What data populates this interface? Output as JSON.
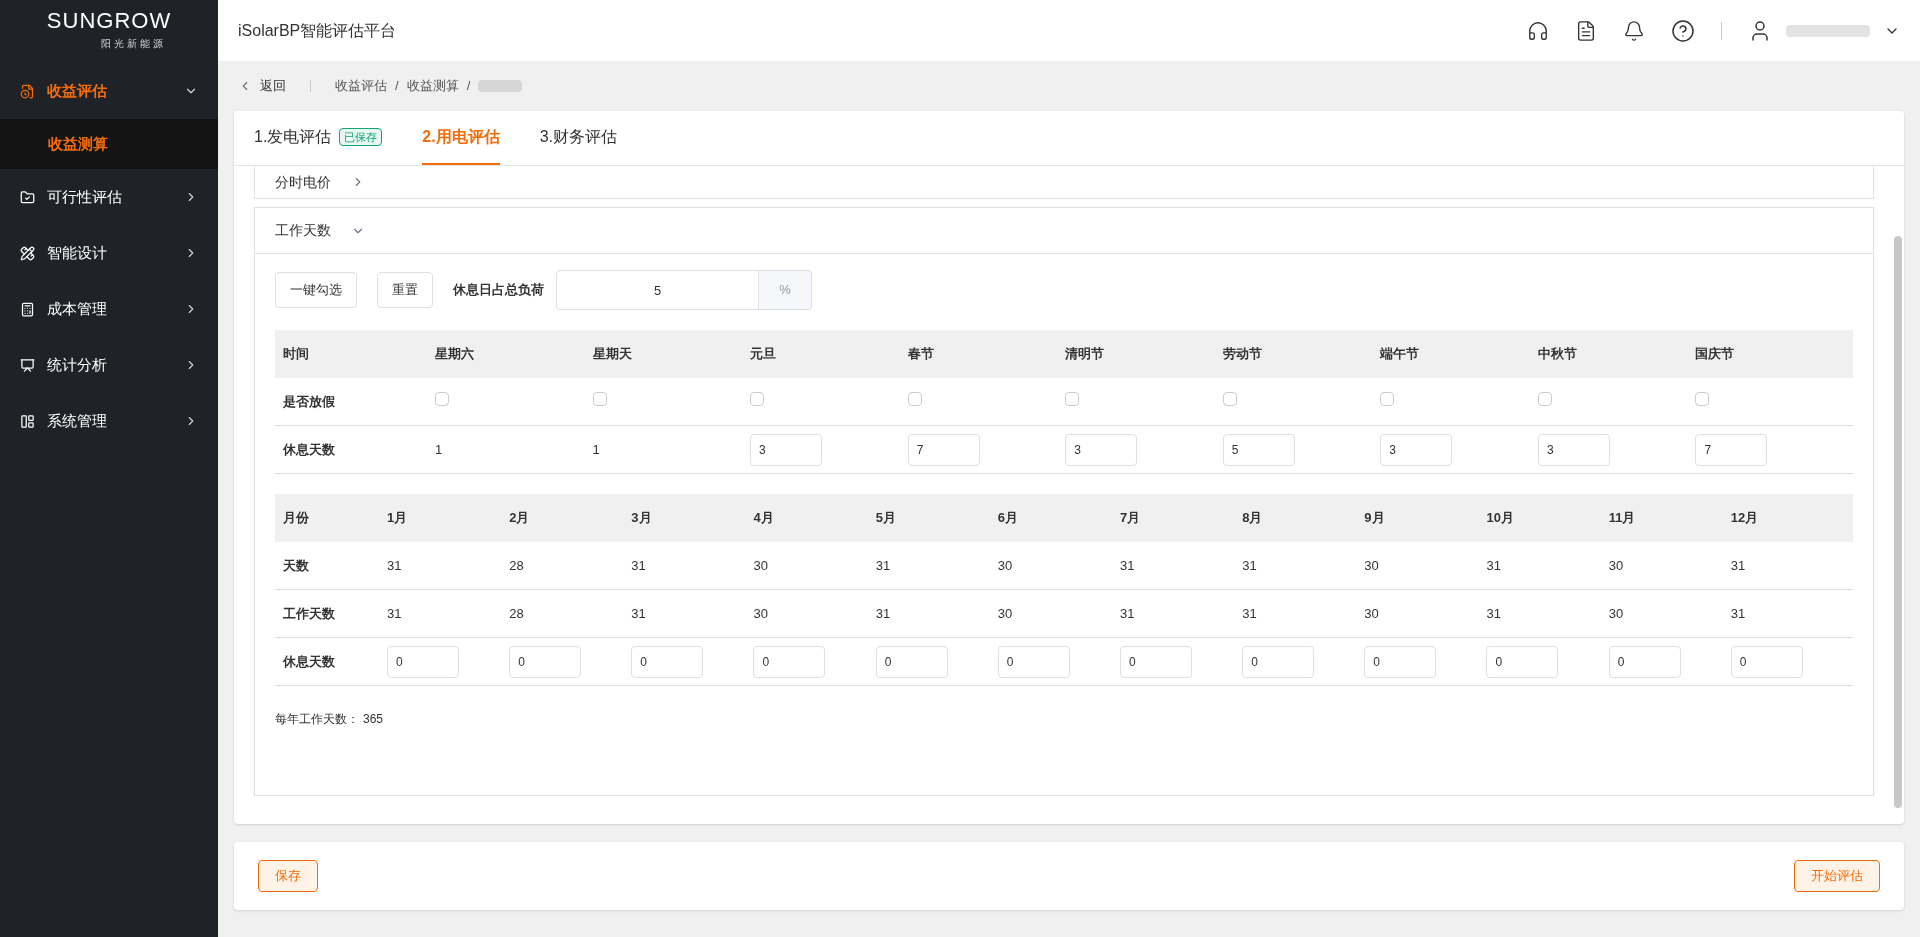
{
  "logo": {
    "brand": "SUNGROW",
    "subtitle": "阳光新能源"
  },
  "sidebar": {
    "items": [
      {
        "label": "收益评估",
        "expanded": true,
        "selected": false,
        "children": [
          {
            "label": "收益测算",
            "selected": true
          }
        ]
      },
      {
        "label": "可行性评估",
        "expanded": false,
        "selected": false
      },
      {
        "label": "智能设计",
        "expanded": false,
        "selected": false
      },
      {
        "label": "成本管理",
        "expanded": false,
        "selected": false
      },
      {
        "label": "统计分析",
        "expanded": false,
        "selected": false
      },
      {
        "label": "系统管理",
        "expanded": false,
        "selected": false
      }
    ]
  },
  "header": {
    "title": "iSolarBP智能评估平台"
  },
  "breadcrumb": {
    "back": "返回",
    "separator": "/",
    "items": [
      "收益评估",
      "收益测算"
    ]
  },
  "tabs": [
    {
      "label": "1.发电评估",
      "badge": "已保存",
      "selected": false
    },
    {
      "label": "2.用电评估",
      "selected": true
    },
    {
      "label": "3.财务评估",
      "selected": false
    }
  ],
  "sections": [
    {
      "title": "分时电价",
      "expanded": false
    },
    {
      "title": "工作天数",
      "expanded": true
    }
  ],
  "toolbar": {
    "buttons": [
      "一键勾选",
      "重置"
    ],
    "ratio_label": "休息日占总负荷",
    "ratio_value": "5",
    "ratio_unit": "%"
  },
  "holiday_table": {
    "header": "时间",
    "row_labels": [
      "是否放假",
      "休息天数"
    ],
    "columns": [
      {
        "name": "星期六",
        "checked": false,
        "kind": "text",
        "days": "1"
      },
      {
        "name": "星期天",
        "checked": false,
        "kind": "text",
        "days": "1"
      },
      {
        "name": "元旦",
        "checked": false,
        "kind": "input",
        "days": "3"
      },
      {
        "name": "春节",
        "checked": false,
        "kind": "input",
        "days": "7"
      },
      {
        "name": "清明节",
        "checked": false,
        "kind": "input",
        "days": "3"
      },
      {
        "name": "劳动节",
        "checked": false,
        "kind": "input",
        "days": "5"
      },
      {
        "name": "端午节",
        "checked": false,
        "kind": "input",
        "days": "3"
      },
      {
        "name": "中秋节",
        "checked": false,
        "kind": "input",
        "days": "3"
      },
      {
        "name": "国庆节",
        "checked": false,
        "kind": "input",
        "days": "7"
      }
    ]
  },
  "month_table": {
    "header": "月份",
    "row_labels": [
      "天数",
      "工作天数",
      "休息天数"
    ],
    "months": [
      {
        "name": "1月",
        "days": "31",
        "work": "31",
        "rest": "0"
      },
      {
        "name": "2月",
        "days": "28",
        "work": "28",
        "rest": "0"
      },
      {
        "name": "3月",
        "days": "31",
        "work": "31",
        "rest": "0"
      },
      {
        "name": "4月",
        "days": "30",
        "work": "30",
        "rest": "0"
      },
      {
        "name": "5月",
        "days": "31",
        "work": "31",
        "rest": "0"
      },
      {
        "name": "6月",
        "days": "30",
        "work": "30",
        "rest": "0"
      },
      {
        "name": "7月",
        "days": "31",
        "work": "31",
        "rest": "0"
      },
      {
        "name": "8月",
        "days": "31",
        "work": "31",
        "rest": "0"
      },
      {
        "name": "9月",
        "days": "30",
        "work": "30",
        "rest": "0"
      },
      {
        "name": "10月",
        "days": "31",
        "work": "31",
        "rest": "0"
      },
      {
        "name": "11月",
        "days": "30",
        "work": "30",
        "rest": "0"
      },
      {
        "name": "12月",
        "days": "31",
        "work": "31",
        "rest": "0"
      }
    ]
  },
  "annual": {
    "label": "每年工作天数：",
    "value": "365"
  },
  "footer": {
    "left": "保存",
    "right": "开始评估"
  }
}
